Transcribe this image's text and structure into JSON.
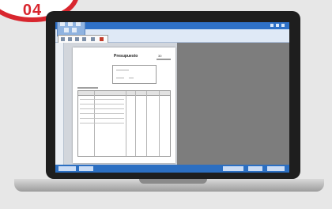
{
  "badge": {
    "text": "04"
  },
  "app": {
    "title": "Presupuesto",
    "number": "30"
  },
  "colors": {
    "titlebar": "#2f71c7",
    "statusbar": "#2c6fc2",
    "ribbon": "#dfe9f6",
    "badge_red": "#d8262e",
    "preview_pane": "#7d7d7d"
  },
  "icons": {
    "logo": "app-logo-icon",
    "toolbar_buttons": [
      "pointer-icon",
      "zoom-icon",
      "page-icon",
      "print-icon",
      "export-icon",
      "close-icon"
    ]
  }
}
